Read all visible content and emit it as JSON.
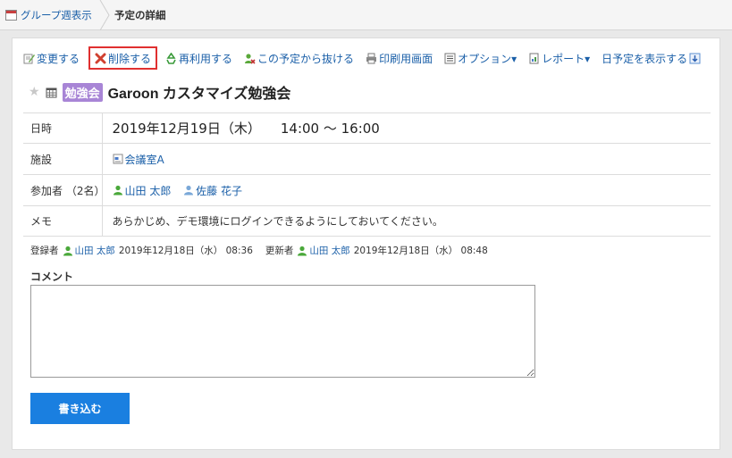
{
  "breadcrumb": {
    "parent": "グループ週表示",
    "current": "予定の詳細"
  },
  "toolbar": {
    "edit": "変更する",
    "delete": "削除する",
    "reuse": "再利用する",
    "leave": "この予定から抜ける",
    "print": "印刷用画面",
    "options": "オプション▾",
    "report": "レポート▾",
    "show_day": "日予定を表示する"
  },
  "event": {
    "menu": "勉強会",
    "title": "Garoon カスタマイズ勉強会"
  },
  "details": {
    "date_label": "日時",
    "date_value": "2019年12月19日（木）",
    "time_value": "14:00 〜 16:00",
    "facility_label": "施設",
    "facility_value": "会議室A",
    "attendees_label": "参加者 （2名）",
    "attendees": [
      "山田 太郎",
      "佐藤 花子"
    ],
    "memo_label": "メモ",
    "memo_value": "あらかじめ、デモ環境にログインできるようにしておいてください。"
  },
  "meta": {
    "registered_label": "登録者",
    "registered_user": "山田 太郎",
    "registered_at": "2019年12月18日（水） 08:36",
    "updated_label": "更新者",
    "updated_user": "山田 太郎",
    "updated_at": "2019年12月18日（水） 08:48"
  },
  "comment": {
    "label": "コメント",
    "placeholder": "",
    "submit": "書き込む"
  },
  "colors": {
    "link": "#1a5fa8",
    "accent_button": "#1a7fe0",
    "highlight_border": "#e03030",
    "menu_badge": "#a885d6"
  }
}
